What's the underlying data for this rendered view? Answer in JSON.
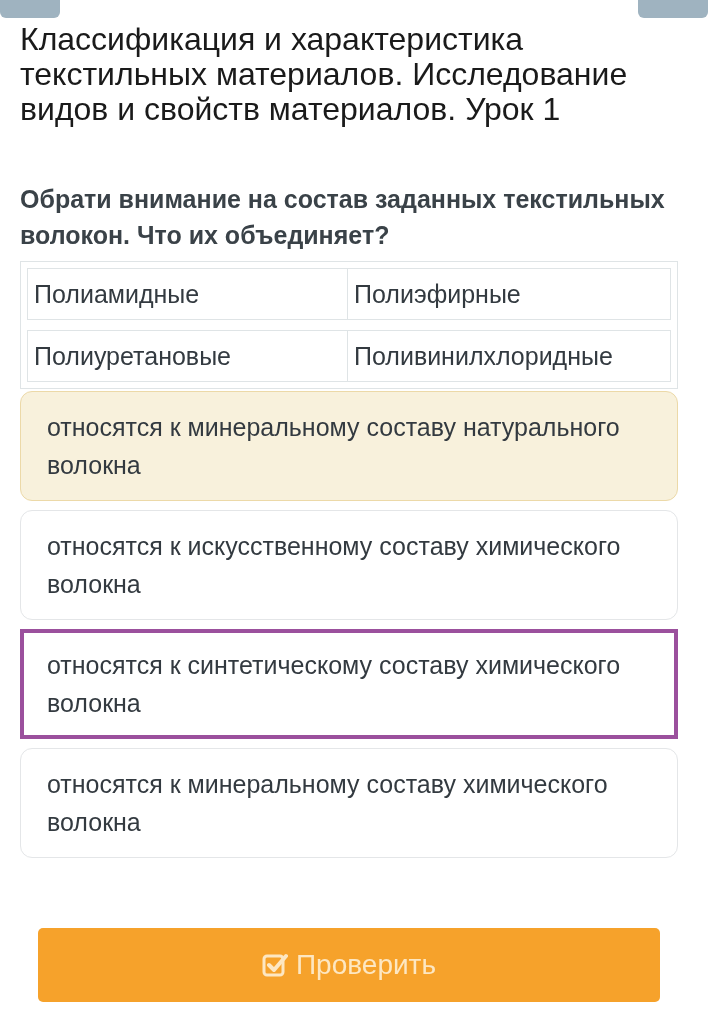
{
  "title": "Классификация и характеристика текстильных материалов. Исследование видов и свойств материалов. Урок 1",
  "question": "Обрати внимание на состав заданных текстильных волокон. Что их объединяет?",
  "table": {
    "rows": [
      [
        "Полиамидные",
        "Полиэфирные"
      ],
      [
        "Полиуретановые",
        "Поливинилхлоридные"
      ]
    ]
  },
  "options": [
    {
      "text": "относятся к минеральному составу натурального волокна",
      "highlighted": true,
      "selected": false
    },
    {
      "text": "относятся к искусственному составу химического волокна",
      "highlighted": false,
      "selected": false
    },
    {
      "text": "относятся к синтетическому составу химического волокна",
      "highlighted": false,
      "selected": true
    },
    {
      "text": "относятся к минеральному составу химического волокна",
      "highlighted": false,
      "selected": false
    }
  ],
  "check_button": {
    "label": "Проверить"
  }
}
